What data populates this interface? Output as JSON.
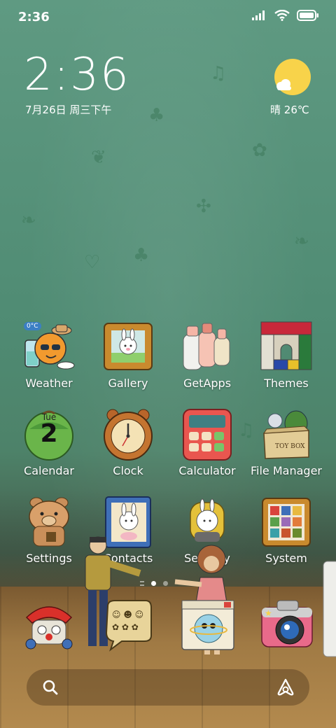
{
  "status_bar": {
    "time": "2:36",
    "icons": [
      "signal-icon",
      "wifi-icon",
      "battery-icon"
    ]
  },
  "clock_widget": {
    "time": "2:36",
    "date": "7月26日 周三下午"
  },
  "weather_widget": {
    "condition": "晴",
    "temperature": "26℃",
    "icon": "sun-cloud-icon"
  },
  "apps": [
    {
      "label": "Weather",
      "icon": "weather-icon",
      "badge": "0°C"
    },
    {
      "label": "Gallery",
      "icon": "gallery-icon"
    },
    {
      "label": "GetApps",
      "icon": "getapps-icon"
    },
    {
      "label": "Themes",
      "icon": "themes-icon"
    },
    {
      "label": "Calendar",
      "icon": "calendar-icon",
      "day": "Tue",
      "date": "2"
    },
    {
      "label": "Clock",
      "icon": "clock-icon"
    },
    {
      "label": "Calculator",
      "icon": "calculator-icon"
    },
    {
      "label": "File Manager",
      "icon": "file-manager-icon",
      "box_text": "TOY BOX"
    },
    {
      "label": "Settings",
      "icon": "settings-icon"
    },
    {
      "label": "Contacts",
      "icon": "contacts-icon"
    },
    {
      "label": "Security",
      "icon": "security-icon"
    },
    {
      "label": "System",
      "icon": "system-icon"
    }
  ],
  "page_indicator": {
    "pages": 2,
    "active": 1
  },
  "dock": [
    {
      "name": "phone",
      "icon": "phone-icon"
    },
    {
      "name": "messages",
      "icon": "messages-icon"
    },
    {
      "name": "browser",
      "icon": "browser-icon"
    },
    {
      "name": "camera",
      "icon": "camera-icon"
    }
  ],
  "search_bar": {
    "left_icon": "search-icon",
    "right_icon": "assistant-icon"
  },
  "colors": {
    "wallpaper_green": "#5f9a82",
    "floor_wood": "#a07a44",
    "sun_yellow": "#f8d34a"
  }
}
